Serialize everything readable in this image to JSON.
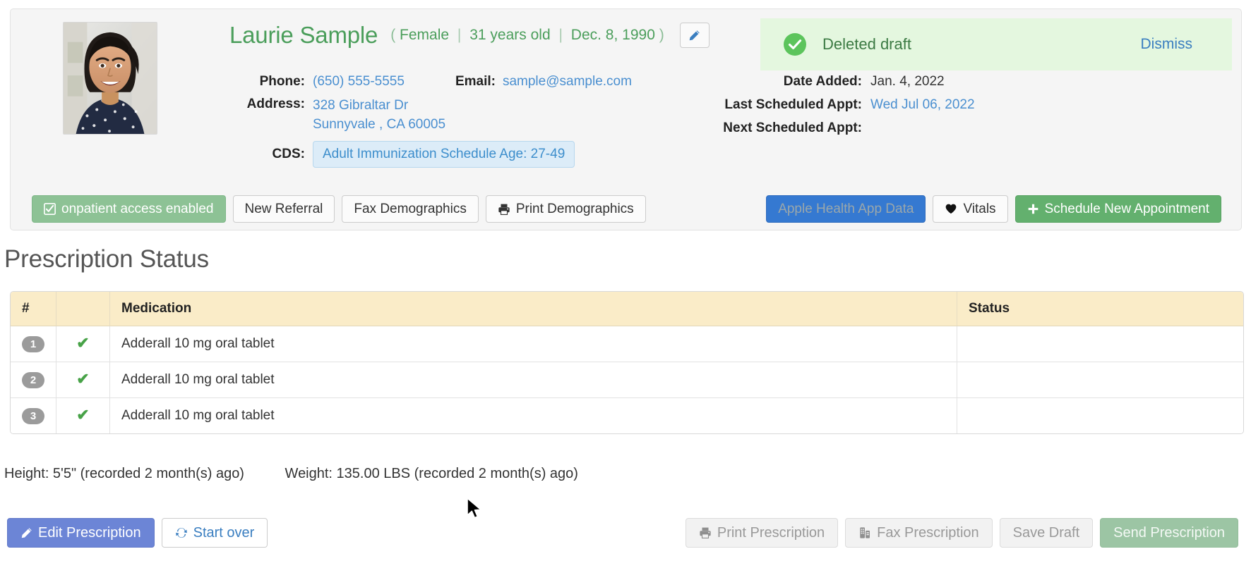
{
  "patient": {
    "name": "Laurie Sample",
    "paren_open": "(",
    "paren_close": ")",
    "gender": "Female",
    "age": "31 years old",
    "dob": "Dec. 8, 1990",
    "photo_alt": "patient-photo",
    "edit_icon": "pencil-icon"
  },
  "demographics": {
    "phone_label": "Phone:",
    "phone_value": "(650) 555-5555",
    "email_label": "Email:",
    "email_value": "sample@sample.com",
    "address_label": "Address:",
    "address_line1": "328 Gibraltar Dr",
    "address_line2": "Sunnyvale , CA 60005",
    "cds_label": "CDS:",
    "cds_value": "Adult Immunization Schedule Age: 27-49"
  },
  "appointments": {
    "date_added_label": "Date Added:",
    "date_added_value": "Jan. 4, 2022",
    "last_appt_label": "Last Scheduled Appt:",
    "last_appt_value": "Wed Jul 06, 2022",
    "next_appt_label": "Next Scheduled Appt:",
    "next_appt_value": ""
  },
  "banner": {
    "icon": "check-circle-icon",
    "message": "Deleted draft",
    "dismiss_label": "Dismiss",
    "background_color": "#e4f7df",
    "icon_color": "#5cc45c",
    "text_color": "#3b7a43",
    "link_color": "#3a7ec0"
  },
  "action_buttons": {
    "left": [
      {
        "label": "onpatient access enabled",
        "icon": "checkbox-checked-icon",
        "style": "green-soft"
      },
      {
        "label": "New Referral",
        "icon": "",
        "style": "default"
      },
      {
        "label": "Fax Demographics",
        "icon": "",
        "style": "default"
      },
      {
        "label": "Print Demographics",
        "icon": "printer-icon",
        "style": "default"
      }
    ],
    "right": [
      {
        "label": "Apple Health App Data",
        "icon": "",
        "style": "blue"
      },
      {
        "label": "Vitals",
        "icon": "heart-icon",
        "style": "default"
      },
      {
        "label": "Schedule New Appointment",
        "icon": "plus-icon",
        "style": "green"
      }
    ]
  },
  "prescription_section": {
    "title": "Prescription Status",
    "columns": [
      "#",
      "",
      "Medication",
      "Status"
    ],
    "rows": [
      {
        "num": "1",
        "check": "✔",
        "medication": "Adderall 10 mg oral tablet",
        "status": ""
      },
      {
        "num": "2",
        "check": "✔",
        "medication": "Adderall 10 mg oral tablet",
        "status": ""
      },
      {
        "num": "3",
        "check": "✔",
        "medication": "Adderall 10 mg oral tablet",
        "status": ""
      }
    ],
    "header_bg": "#faecc8",
    "check_color": "#47a247",
    "badge_bg": "#9b9b9b"
  },
  "vitals": {
    "height_text": "Height: 5'5\" (recorded 2 month(s) ago)",
    "weight_text": "Weight: 135.00 LBS (recorded 2 month(s) ago)"
  },
  "bottom_bar": {
    "left": [
      {
        "label": "Edit Prescription",
        "icon": "pencil-icon",
        "style": "periwinkle"
      },
      {
        "label": "Start over",
        "icon": "refresh-icon",
        "style": "white-blue"
      }
    ],
    "right": [
      {
        "label": "Print Prescription",
        "icon": "printer-icon",
        "style": "disabled"
      },
      {
        "label": "Fax Prescription",
        "icon": "fax-icon",
        "style": "disabled"
      },
      {
        "label": "Save Draft",
        "icon": "",
        "style": "disabled"
      },
      {
        "label": "Send Prescription",
        "icon": "",
        "style": "disabled-green"
      }
    ]
  }
}
